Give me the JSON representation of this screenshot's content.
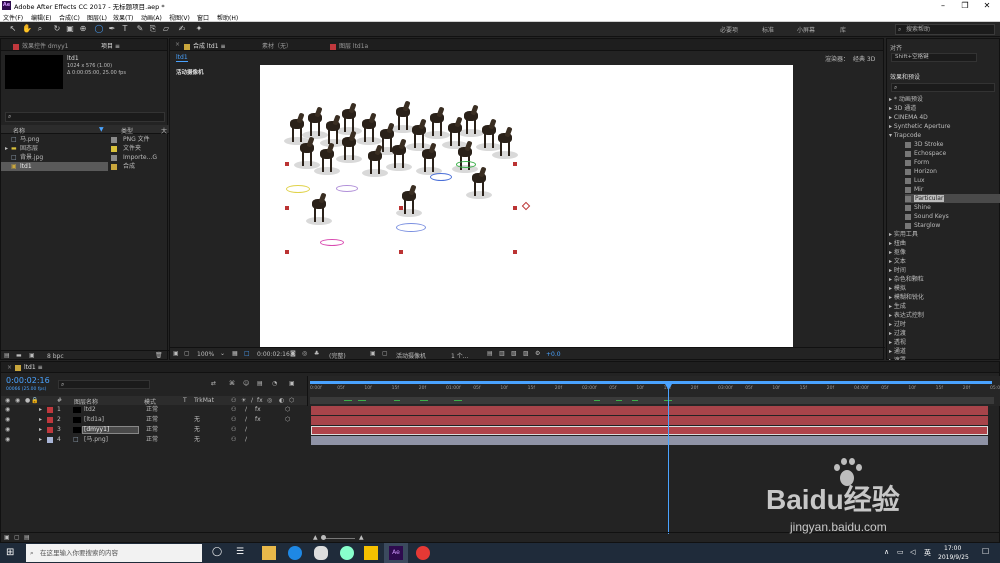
{
  "window": {
    "title": "Adobe After Effects CC 2017 - 无标题项目.aep *",
    "app_icon": "Ae"
  },
  "menu": [
    "文件(F)",
    "编辑(E)",
    "合成(C)",
    "图层(L)",
    "效果(T)",
    "动画(A)",
    "视图(V)",
    "窗口",
    "帮助(H)"
  ],
  "workspaces": [
    "必要项",
    "标准",
    "小屏幕",
    "库"
  ],
  "help_search": {
    "placeholder": "搜索帮助"
  },
  "project": {
    "tab_effects": "效果控件 dmyy1",
    "tab_project": "项目",
    "selected_name": "ltd1",
    "selected_info1": "1024 x 576 (1.00)",
    "selected_info2": "Δ 0:00:05:00, 25.00 fps",
    "col_name": "名称",
    "col_type": "类型",
    "col_size": "大",
    "items": [
      {
        "name": "马.png",
        "type": "PNG 文件",
        "color": "#8a8a8a"
      },
      {
        "name": "固态层",
        "type": "文件夹",
        "color": "#d8c13a"
      },
      {
        "name": "背景.jpg",
        "type": "Importe...G",
        "color": "#8a8a8a"
      },
      {
        "name": "ltd1",
        "type": "合成",
        "color": "#c9a63c"
      }
    ],
    "bpc": "8 bpc"
  },
  "composition": {
    "tab_comp": "合成 ltd1",
    "tab_footage": "素材（无）",
    "tab_layer": "图层 ltd1a",
    "breadcrumb": "ltd1",
    "renderer_label": "渲染器：",
    "renderer_value": "经典 3D",
    "active_camera_label": "活动摄像机",
    "zoom": "100%",
    "timecode": "0:00:02:16",
    "resolution": "(完整)",
    "view": "活动摄像机",
    "views": "1 个...",
    "exposure": "+0.0"
  },
  "right_panel": {
    "align_label": "对齐",
    "search_value": "Shift+空格键",
    "effects_title": "效果和预设",
    "categories": [
      "* 动画预设",
      "3D 通道",
      "CINEMA 4D",
      "Synthetic Aperture",
      "Trapcode"
    ],
    "trapcode_items": [
      "3D Stroke",
      "Echospace",
      "Form",
      "Horizon",
      "Lux",
      "Mir",
      "Particular",
      "Shine",
      "Sound Keys",
      "Starglow"
    ],
    "more_categories": [
      "实用工具",
      "扭曲",
      "抠像",
      "文本",
      "时间",
      "杂色和颗粒",
      "模拟",
      "模糊和锐化",
      "生成",
      "表达式控制",
      "过时",
      "过渡",
      "透视",
      "通道",
      "遮罩"
    ],
    "selected_effect": "Particular"
  },
  "timeline": {
    "tab": "ltd1",
    "timecode": "0:00:02:16",
    "sub_timecode": "00066 (25.00 fps)",
    "header": {
      "num": "#",
      "name": "图层名称",
      "mode": "模式",
      "t": "T",
      "trkmat": "TrkMat"
    },
    "layers": [
      {
        "num": "1",
        "name": "ltd2",
        "mode": "正常",
        "trkmat": "",
        "color": "#c0383d",
        "bar_color": "#a8444a"
      },
      {
        "num": "2",
        "name": "[ltd1a]",
        "mode": "正常",
        "trkmat": "无",
        "color": "#c0383d",
        "bar_color": "#a8444a"
      },
      {
        "num": "3",
        "name": "[dmyy1]",
        "mode": "正常",
        "trkmat": "无",
        "color": "#c0383d",
        "bar_color": "#b0444a"
      },
      {
        "num": "4",
        "name": "[马.png]",
        "mode": "正常",
        "trkmat": "无",
        "color": "#a9b5d6",
        "bar_color": "#8f93a6"
      }
    ],
    "ruler": [
      "0:00f",
      "05f",
      "10f",
      "15f",
      "20f",
      "01:00f",
      "05f",
      "10f",
      "15f",
      "20f",
      "02:00f",
      "05f",
      "10f",
      "15f",
      "20f",
      "03:00f",
      "05f",
      "10f",
      "15f",
      "20f",
      "04:00f",
      "05f",
      "10f",
      "15f",
      "20f",
      "05:0"
    ]
  },
  "taskbar": {
    "search_placeholder": "在这里输入你要搜索的内容",
    "time": "17:00",
    "date": "2019/9/25",
    "ime": "英"
  },
  "watermark": {
    "brand": "Baidu经验",
    "url": "jingyan.baidu.com"
  }
}
